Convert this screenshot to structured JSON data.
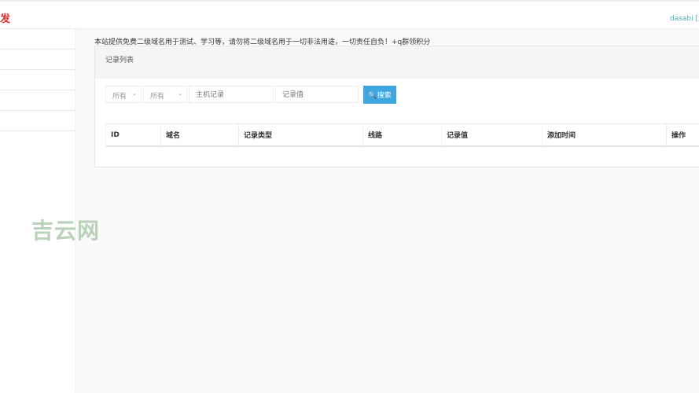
{
  "header": {
    "brand": "发",
    "user": "dasabi [退"
  },
  "notice": "本站提供免费二级域名用于测试、学习等，请勿将二级域名用于一切非法用途，一切责任自负！+q群领积分",
  "panel": {
    "title": "记录列表"
  },
  "filters": {
    "select1": "所有",
    "select2": "所有",
    "host_placeholder": "主机记录",
    "value_placeholder": "记录值",
    "search_label": "搜索"
  },
  "table": {
    "columns": [
      "ID",
      "域名",
      "记录类型",
      "线路",
      "记录值",
      "添加时间",
      "操作"
    ]
  },
  "watermark": "吉云网",
  "colors": {
    "brand": "#d9302c",
    "accent": "#3fa6e0"
  }
}
